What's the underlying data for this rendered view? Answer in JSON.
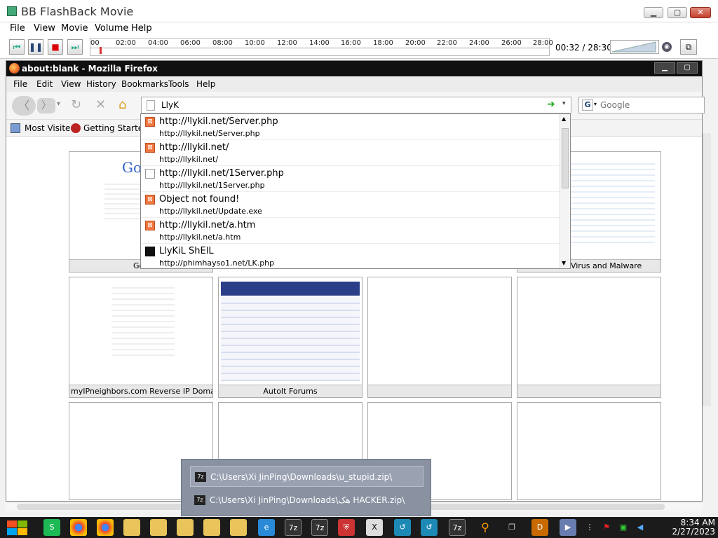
{
  "bb": {
    "title": "BB FlashBack Movie",
    "menu": [
      "File",
      "View",
      "Movie",
      "Volume",
      "Help"
    ],
    "timeline_ticks": [
      "00",
      "02:00",
      "04:00",
      "06:00",
      "08:00",
      "10:00",
      "12:00",
      "14:00",
      "16:00",
      "18:00",
      "20:00",
      "22:00",
      "24:00",
      "26:00",
      "28:00"
    ],
    "timecode": "00:32 / 28:30"
  },
  "firefox": {
    "title": "about:blank - Mozilla Firefox",
    "menu": [
      "File",
      "Edit",
      "View",
      "History",
      "Bookmarks",
      "Tools",
      "Help"
    ],
    "url_value": "LlyK",
    "search_placeholder": "Google",
    "bookmarks": [
      "Most Visited",
      "Getting Started"
    ]
  },
  "autocomplete": [
    {
      "title": "http://llykil.net/Server.php",
      "url": "http://llykil.net/Server.php",
      "icon": "xampp-icon"
    },
    {
      "title": "http://llykil.net/",
      "url": "http://llykil.net/",
      "icon": "xampp-icon"
    },
    {
      "title": "http://llykil.net/1Server.php",
      "url": "http://llykil.net/1Server.php",
      "icon": "page-icon"
    },
    {
      "title": "Object not found!",
      "url": "http://llykil.net/Update.exe",
      "icon": "xampp-icon"
    },
    {
      "title": "http://llykil.net/a.htm",
      "url": "http://llykil.net/a.htm",
      "icon": "xampp-icon"
    },
    {
      "title": "LlyKiL ShElL",
      "url": "http://phimhayso1.net/LK.php",
      "icon": "shell-icon"
    }
  ],
  "thumbnails": [
    "Goo",
    "e Online Virus and Malware",
    "myIPneighbors.com Reverse IP Domain Ch",
    "AutoIt Forums"
  ],
  "popup": [
    "C:\\Users\\Xi JinPing\\Downloads\\u_stupid.zip\\",
    "C:\\Users\\Xi JinPing\\Downloads\\هک HACKER.zip\\"
  ],
  "clock": {
    "time": "8:34 AM",
    "date": "2/27/2023"
  }
}
